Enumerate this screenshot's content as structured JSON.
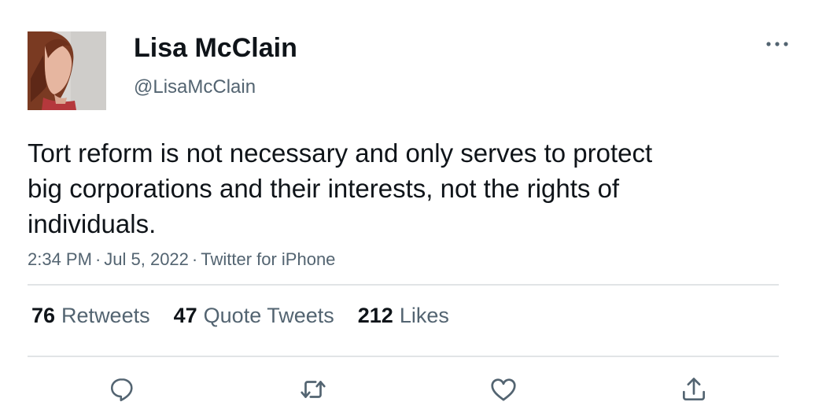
{
  "author": {
    "display_name": "Lisa McClain",
    "handle": "@LisaMcClain"
  },
  "tweet": {
    "text": "Tort reform is not necessary and only serves to protect big corporations and their interests, not the rights of individuals.",
    "time": "2:34 PM",
    "date": "Jul 5, 2022",
    "source": "Twitter for iPhone",
    "separator": "·"
  },
  "stats": {
    "retweets": {
      "count": "76",
      "label": "Retweets"
    },
    "quote_tweets": {
      "count": "47",
      "label": "Quote Tweets"
    },
    "likes": {
      "count": "212",
      "label": "Likes"
    }
  },
  "icons": {
    "more": "more-horizontal-icon",
    "reply": "reply-icon",
    "retweet": "retweet-icon",
    "like": "heart-icon",
    "share": "share-icon"
  },
  "colors": {
    "text_primary": "#0f1419",
    "text_secondary": "#536471",
    "divider": "#e1e4e6"
  }
}
